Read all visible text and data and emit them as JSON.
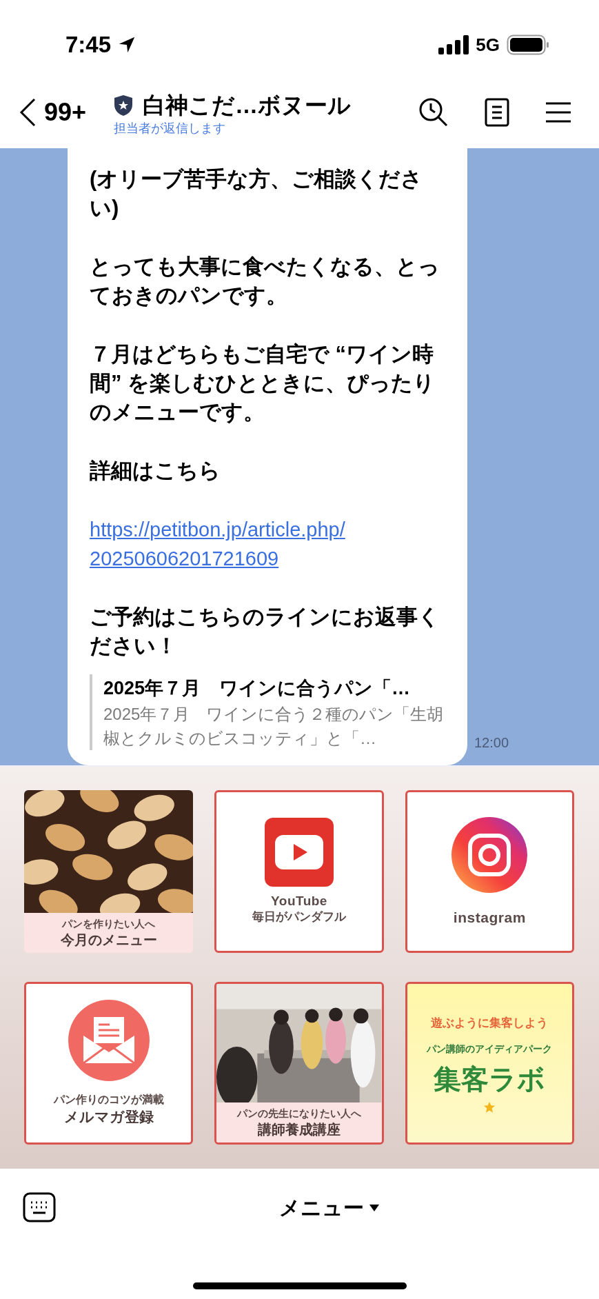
{
  "status_bar": {
    "time": "7:45",
    "network": "5G"
  },
  "header": {
    "back_count": "99+",
    "title": "白神こだ…ボヌール",
    "subtitle": "担当者が返信します"
  },
  "message": {
    "paragraphs": [
      "(オリーブ苦手な方、ご相談ください)",
      "とっても大事に食べたくなる、とっておきのパンです。",
      "７月はどちらもご自宅で “ワイン時間” を楽しむひとときに、ぴったりのメニューです。",
      "詳細はこちら"
    ],
    "link": "https://petitbon.jp/article.php/20250606201721609",
    "closing": "ご予約はこちらのラインにお返事ください！",
    "preview": {
      "title": "2025年７月　ワインに合うパン「…",
      "description": "2025年７月　ワインに合う２種のパン「生胡椒とクルミのビスコッティ」と「…"
    },
    "time": "12:00"
  },
  "rich_menu": {
    "tiles": [
      {
        "caption_small": "パンを作りたい人へ",
        "caption_large": "今月のメニュー"
      },
      {
        "kind": "youtube",
        "label": "YouTube",
        "caption_small": "毎日がパンダフル"
      },
      {
        "kind": "instagram",
        "label": "instagram"
      },
      {
        "kind": "mail",
        "caption_small": "パン作りのコツが満載",
        "caption_large": "メルマガ登録"
      },
      {
        "kind": "class_photo",
        "caption_small": "パンの先生になりたい人へ",
        "caption_large": "講師養成講座"
      },
      {
        "kind": "lab",
        "headline": "**遊**ぶように**集客**しよう",
        "subtitle": "パン講師のアイディアパーク",
        "label": "集客ラボ"
      }
    ]
  },
  "bottom_bar": {
    "menu_label": "メニュー"
  }
}
